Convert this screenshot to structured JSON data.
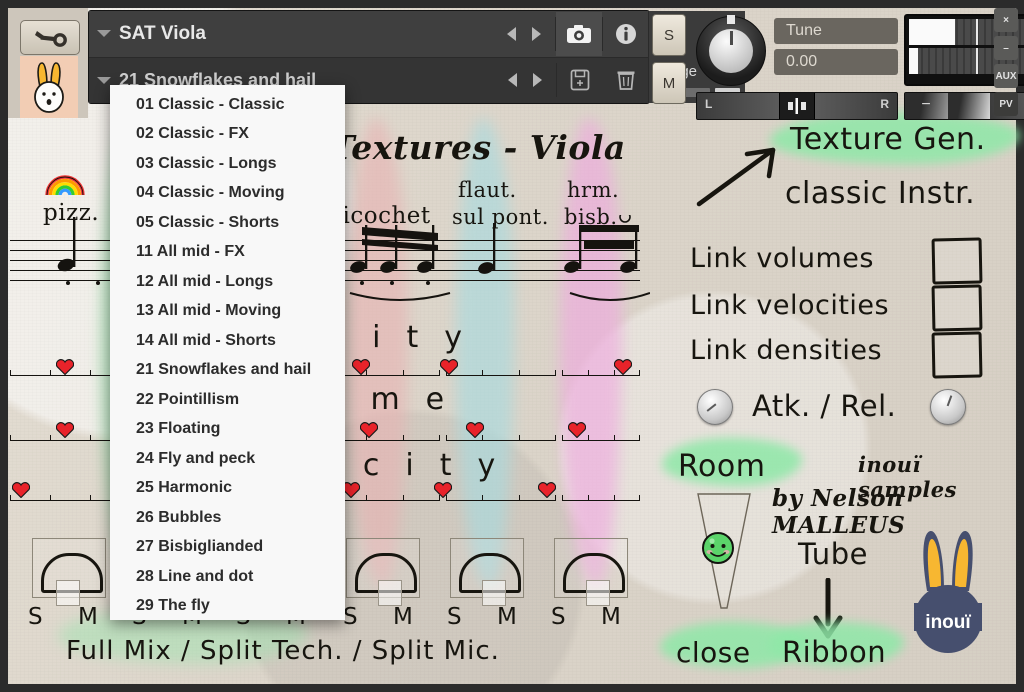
{
  "window": {
    "buttons": [
      {
        "name": "close",
        "label": "×"
      },
      {
        "name": "minimize",
        "label": "–"
      },
      {
        "name": "aux",
        "label": "AUX"
      },
      {
        "name": "pv",
        "label": "PV"
      }
    ]
  },
  "rail": {
    "wrench_icon": "wrench-icon",
    "logo_icon": "bunny-logo-icon"
  },
  "instrument": {
    "name": "SAT Viola",
    "preset": "21 Snowflakes and hail",
    "purge_label": "Purge",
    "icons": [
      "snapshot-camera-icon",
      "info-icon",
      "save-icon",
      "delete-icon"
    ]
  },
  "strip": {
    "solo_label": "S",
    "mute_label": "M",
    "tune_label": "Tune",
    "tune_value": "0.00",
    "pan_left": "L",
    "pan_right": "R",
    "vol_minus": "−",
    "vol_plus": "+"
  },
  "dropdown": {
    "open": true,
    "items": [
      "01 Classic - Classic",
      "02 Classic - FX",
      "03 Classic - Longs",
      "04 Classic - Moving",
      "05 Classic - Shorts",
      "11 All mid - FX",
      "12 All mid - Longs",
      "13 All mid - Moving",
      "14 All mid - Shorts",
      "21 Snowflakes and hail",
      "22 Pointillism",
      "23 Floating",
      "24 Fly and peck",
      "25 Harmonic",
      "26 Bubbles",
      "27 Bisbiglianded",
      "28 Line and dot",
      "29 The fly"
    ],
    "selected": "21 Snowflakes and hail"
  },
  "score": {
    "title": "Textures - Viola",
    "rainbow_icon": "rainbow-icon",
    "techniques": [
      {
        "id": "tech-1",
        "label": "pizz.",
        "color": "#9fe3b0"
      },
      {
        "id": "tech-2",
        "label": "ricochet",
        "color": "#e8b3b3"
      },
      {
        "id": "tech-3",
        "label": "flaut.",
        "label2": "sul pont.",
        "color": "#a7dbe0"
      },
      {
        "id": "tech-4",
        "label": "hrm.",
        "label2": "bisb.",
        "color": "#f0a8e0"
      }
    ],
    "row_labels": [
      "density",
      "volume",
      "velocity"
    ]
  },
  "mixer": {
    "mic_labels": [
      "S",
      "M",
      "S",
      "M",
      "S",
      "M",
      "S",
      "M",
      "S",
      "M",
      "S",
      "M"
    ],
    "footer": "Full Mix / Split Tech. / Split Mic."
  },
  "annotations": {
    "texture_gen": "Texture Gen.",
    "classic_instr": "classic Instr.",
    "link_volumes": "Link volumes",
    "link_velocities": "Link velocities",
    "link_densities": "Link densities",
    "atk_rel": "Atk. / Rel.",
    "room": "Room",
    "close": "close",
    "tube": "Tube",
    "ribbon": "Ribbon",
    "credit_line1": "inouï samples",
    "credit_line2": "by Nelson MALLEUS",
    "logo_text": "inouï"
  },
  "colors": {
    "paper": "#ddd6cb",
    "ink": "#17150f",
    "highlight_green": "#8fe8a8",
    "brand_navy": "#464f6e",
    "brand_yellow": "#f7b731",
    "heart_red": "#e8232a",
    "kontakt_panel": "#3d3d3d"
  }
}
